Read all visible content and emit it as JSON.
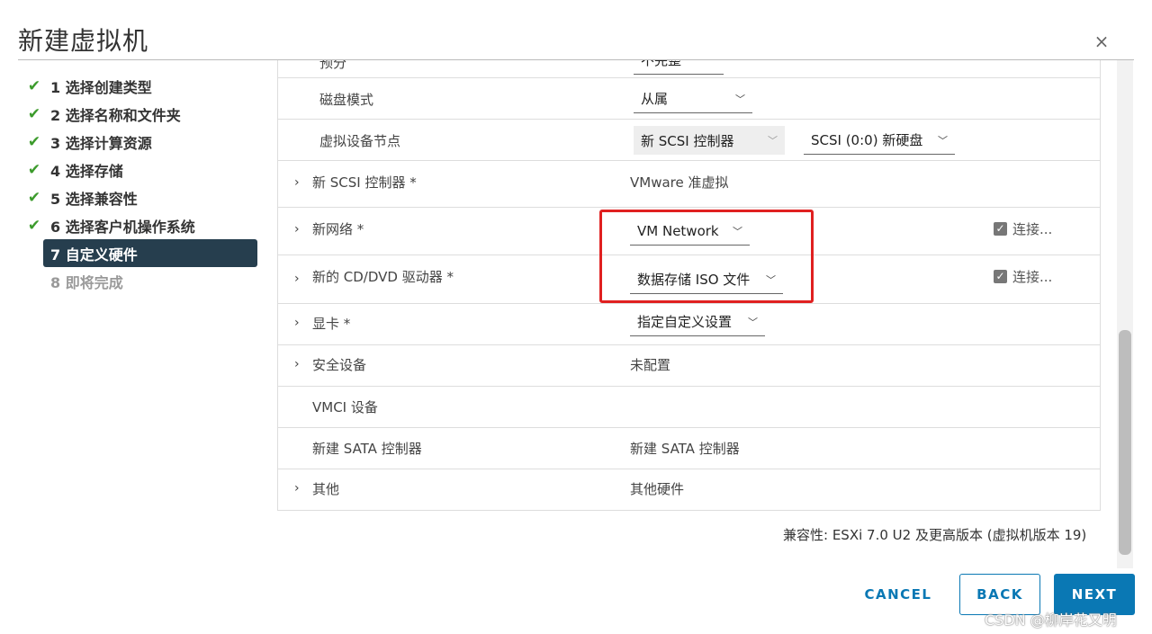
{
  "dialog": {
    "title": "新建虚拟机",
    "close_symbol": "×"
  },
  "steps": [
    {
      "label": "1 选择创建类型",
      "status": "done"
    },
    {
      "label": "2 选择名称和文件夹",
      "status": "done"
    },
    {
      "label": "3 选择计算资源",
      "status": "done"
    },
    {
      "label": "4 选择存储",
      "status": "done"
    },
    {
      "label": "5 选择兼容性",
      "status": "done"
    },
    {
      "label": "6 选择客户机操作系统",
      "status": "done"
    },
    {
      "label": "7 自定义硬件",
      "status": "active"
    },
    {
      "label": "8 即将完成",
      "status": "pending"
    }
  ],
  "hardware": {
    "cut_row": {
      "label": "预分",
      "value": "不完整"
    },
    "disk_mode": {
      "label": "磁盘模式",
      "value": "从属"
    },
    "virtual_device_node": {
      "label": "虚拟设备节点",
      "controller": "新 SCSI 控制器",
      "node": "SCSI (0:0) 新硬盘"
    },
    "scsi_controller": {
      "label": "新 SCSI 控制器 *",
      "value": "VMware 准虚拟"
    },
    "network": {
      "label": "新网络 *",
      "value": "VM Network",
      "connect_label": "连接..."
    },
    "cd_dvd": {
      "label": "新的 CD/DVD 驱动器 *",
      "value": "数据存储 ISO 文件",
      "connect_label": "连接..."
    },
    "video_card": {
      "label": "显卡 *",
      "value": "指定自定义设置"
    },
    "security": {
      "label": "安全设备",
      "value": "未配置"
    },
    "vmci": {
      "label": "VMCI 设备"
    },
    "sata": {
      "label": "新建 SATA 控制器",
      "value": "新建 SATA 控制器"
    },
    "other": {
      "label": "其他",
      "value": "其他硬件"
    }
  },
  "compatibility": "兼容性: ESXi 7.0 U2 及更高版本 (虚拟机版本 19)",
  "buttons": {
    "cancel": "CANCEL",
    "back": "BACK",
    "next": "NEXT"
  },
  "watermark": "CSDN @柳岸花又明",
  "colors": {
    "accent": "#0a78b4",
    "check": "#3c9b2c",
    "active_step": "#263e4e",
    "highlight": "#e02020"
  }
}
